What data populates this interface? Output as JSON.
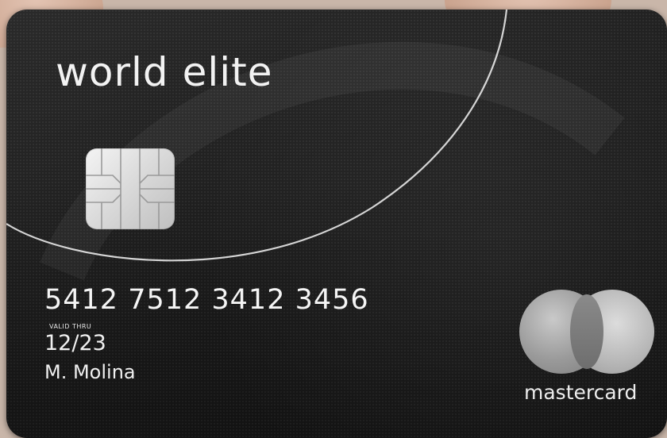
{
  "card": {
    "tier": "world elite",
    "number": "5412 7512 3412 3456",
    "valid_label": "VALID THRU",
    "expiry": "12/23",
    "holder": "M. Molina",
    "brand": "mastercard"
  },
  "icons": [
    "chip-icon",
    "mastercard-logo-icon"
  ],
  "colors": {
    "card": "#1c1c1c",
    "text": "#f2f2f2",
    "logo": "#bdbdbd"
  }
}
